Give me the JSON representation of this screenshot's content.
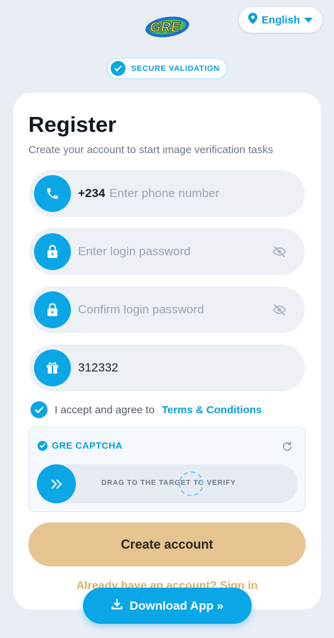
{
  "header": {
    "logo_text": "GRE",
    "language": "English"
  },
  "badge": {
    "label": "SECURE VALIDATION"
  },
  "form": {
    "title": "Register",
    "subtitle": "Create your account to start image verification tasks",
    "phone": {
      "country_code": "+234",
      "placeholder": "Enter phone number"
    },
    "password": {
      "placeholder": "Enter login password"
    },
    "confirm_password": {
      "placeholder": "Confirm login password"
    },
    "invite_code": {
      "value": "312332"
    },
    "terms": {
      "prefix": "I accept and agree to",
      "link": "Terms & Conditions",
      "checked": true
    }
  },
  "captcha": {
    "title": "GRE CAPTCHA",
    "instruction": "DRAG TO THE TARGET TO VERIFY"
  },
  "actions": {
    "create": "Create account",
    "signin": "Already have an account? Sign in",
    "download": "Download App »"
  },
  "colors": {
    "accent": "#0aa6e6",
    "button_gold": "#e6c48f",
    "background": "#e9eef4"
  }
}
